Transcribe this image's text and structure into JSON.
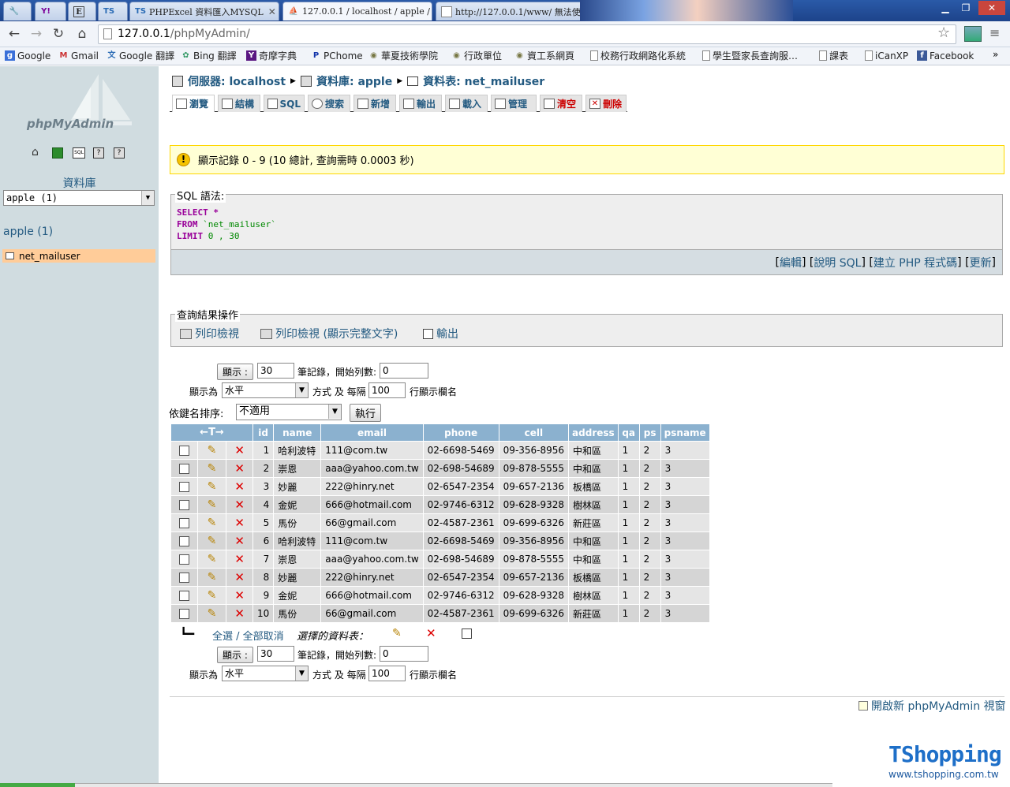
{
  "browser": {
    "tabs": [
      {
        "label": "",
        "icon": "wrench-icon"
      },
      {
        "label": "",
        "icon": "yahoo-icon"
      },
      {
        "label": "",
        "icon": "e-icon"
      },
      {
        "label": "",
        "icon": "ts-icon"
      },
      {
        "label": "PHPExcel 資料匯入MYSQL",
        "icon": "ts-icon"
      },
      {
        "label": "127.0.0.1 / localhost / apple /",
        "icon": "pma-icon"
      },
      {
        "label": "http://127.0.0.1/www/ 無法使",
        "icon": "page-icon"
      }
    ],
    "url_host": "127.0.0.1",
    "url_path": "/phpMyAdmin/",
    "bookmarks": [
      "Google",
      "Gmail",
      "Google 翻譯",
      "Bing 翻譯",
      "奇摩字典",
      "PChome",
      "華夏技術學院",
      "行政單位",
      "資工系網頁",
      "校務行政網路化系統",
      "學生暨家長查詢服…",
      "課表",
      "iCanXP",
      "Facebook"
    ]
  },
  "sidebar": {
    "logo": "phpMyAdmin",
    "db_label": "資料庫",
    "db_select": "apple (1)",
    "db_link": "apple (1)",
    "table_item": "net_mailuser"
  },
  "breadcrumb": {
    "server": "伺服器: localhost",
    "database": "資料庫: apple",
    "table": "資料表: net_mailuser"
  },
  "menu": [
    "瀏覽",
    "結構",
    "SQL",
    "搜索",
    "新增",
    "輸出",
    "載入",
    "管理",
    "清空",
    "刪除"
  ],
  "notice": "顯示記錄 0 - 9 (10 總計, 查詢需時 0.0003 秒)",
  "sql_box": {
    "legend": "SQL 語法:",
    "line1_kw": "SELECT *",
    "line2_kw": "FROM",
    "line2_tbl": "`net_mailuser`",
    "line3_kw": "LIMIT",
    "line3_val": "0 , 30",
    "links": [
      "[ ",
      "編輯",
      " ] [ ",
      "說明 SQL",
      " ] [ ",
      "建立 PHP 程式碼",
      " ] [ ",
      "更新",
      " ]"
    ]
  },
  "ops": {
    "legend": "查詢結果操作",
    "print": "列印檢視",
    "print_full": "列印檢視 (顯示完整文字)",
    "export": "輸出"
  },
  "nav": {
    "show_btn": "顯示 :",
    "rows": "30",
    "rows_label": "筆記錄，開始列數:",
    "start": "0",
    "mode_label": "顯示為",
    "mode": "水平",
    "repeat_label": "方式 及 每隔",
    "repeat": "100",
    "repeat_suffix": "行顯示欄名",
    "sort_label": "依鍵名排序:",
    "sort_value": "不適用",
    "go": "執行"
  },
  "table": {
    "headers": [
      "id",
      "name",
      "email",
      "phone",
      "cell",
      "address",
      "qa",
      "ps",
      "psname"
    ],
    "rows": [
      [
        "1",
        "哈利波特",
        "111@com.tw",
        "02-6698-5469",
        "09-356-8956",
        "中和區",
        "1",
        "2",
        "3"
      ],
      [
        "2",
        "崇恩",
        "aaa@yahoo.com.tw",
        "02-698-54689",
        "09-878-5555",
        "中和區",
        "1",
        "2",
        "3"
      ],
      [
        "3",
        "妙麗",
        "222@hinry.net",
        "02-6547-2354",
        "09-657-2136",
        "板橋區",
        "1",
        "2",
        "3"
      ],
      [
        "4",
        "金妮",
        "666@hotmail.com",
        "02-9746-6312",
        "09-628-9328",
        "樹林區",
        "1",
        "2",
        "3"
      ],
      [
        "5",
        "馬份",
        "66@gmail.com",
        "02-4587-2361",
        "09-699-6326",
        "新莊區",
        "1",
        "2",
        "3"
      ],
      [
        "6",
        "哈利波特",
        "111@com.tw",
        "02-6698-5469",
        "09-356-8956",
        "中和區",
        "1",
        "2",
        "3"
      ],
      [
        "7",
        "崇恩",
        "aaa@yahoo.com.tw",
        "02-698-54689",
        "09-878-5555",
        "中和區",
        "1",
        "2",
        "3"
      ],
      [
        "8",
        "妙麗",
        "222@hinry.net",
        "02-6547-2354",
        "09-657-2136",
        "板橋區",
        "1",
        "2",
        "3"
      ],
      [
        "9",
        "金妮",
        "666@hotmail.com",
        "02-9746-6312",
        "09-628-9328",
        "樹林區",
        "1",
        "2",
        "3"
      ],
      [
        "10",
        "馬份",
        "66@gmail.com",
        "02-4587-2361",
        "09-699-6326",
        "新莊區",
        "1",
        "2",
        "3"
      ]
    ],
    "check_all": "全選 / 全部取消",
    "with_selected": "選擇的資料表："
  },
  "footer": {
    "new_window": "開啟新 phpMyAdmin 視窗",
    "watermark": "TShopping",
    "watermark_url": "www.tshopping.com.tw"
  }
}
